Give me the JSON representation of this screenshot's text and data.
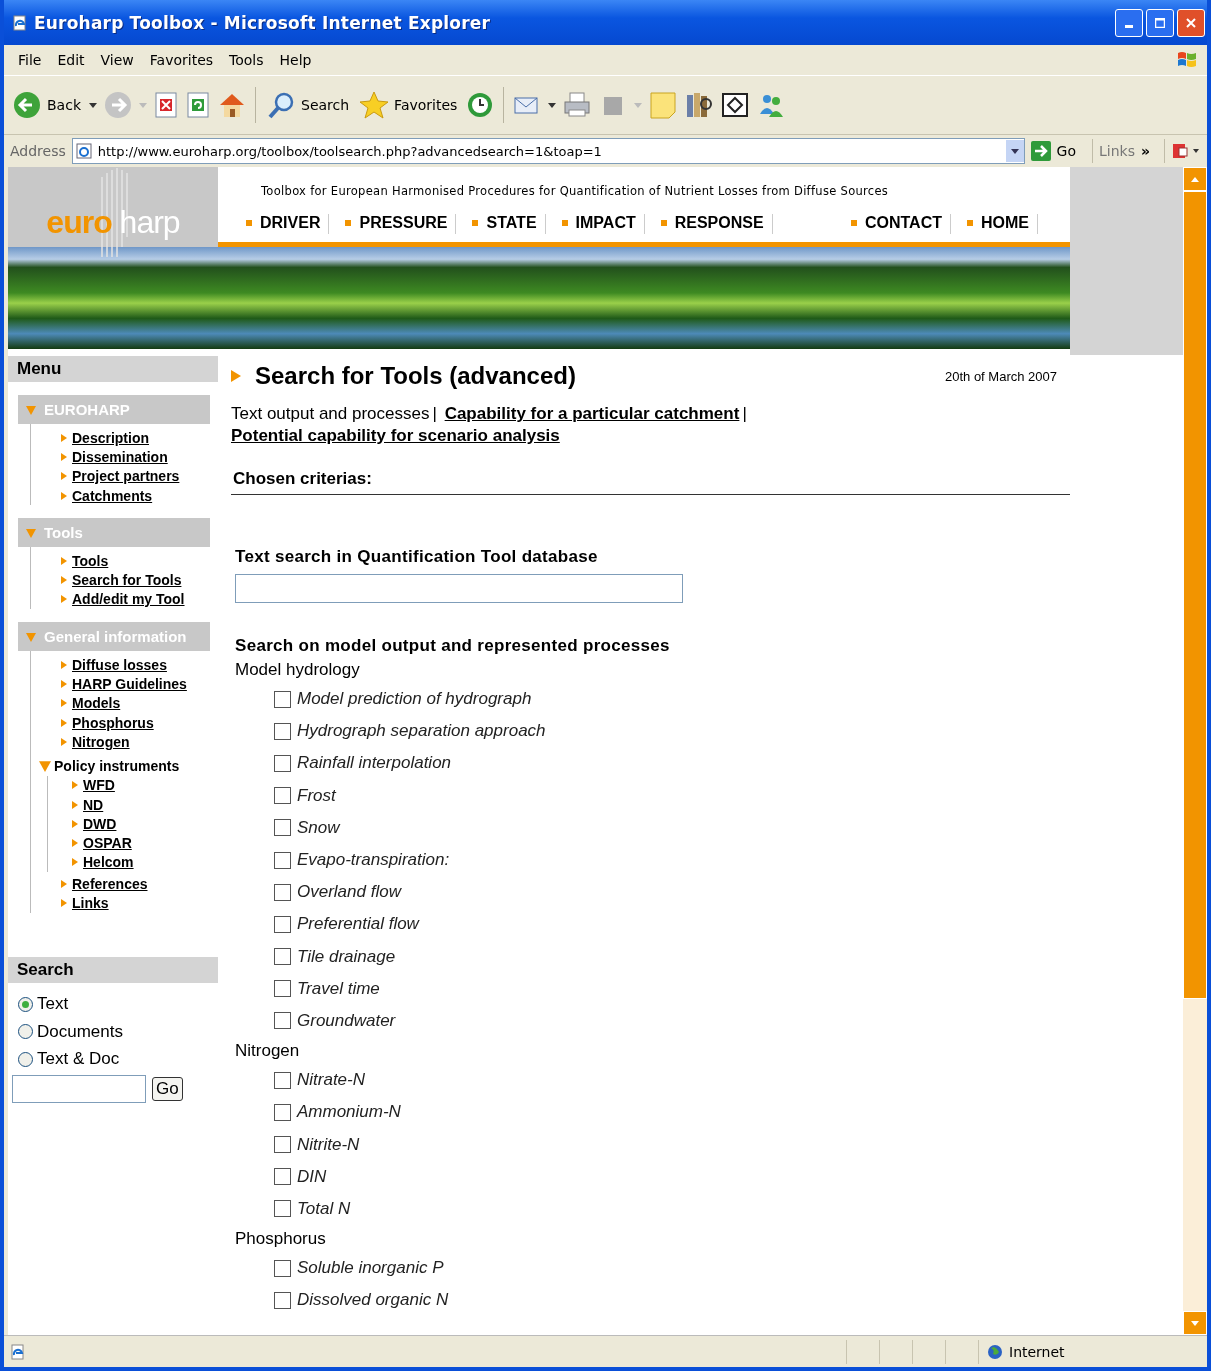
{
  "window": {
    "title": "Euroharp Toolbox - Microsoft Internet Explorer"
  },
  "menu_bar": [
    "File",
    "Edit",
    "View",
    "Favorites",
    "Tools",
    "Help"
  ],
  "toolbar": {
    "back": "Back",
    "search": "Search",
    "favorites": "Favorites"
  },
  "address_bar": {
    "label": "Address",
    "url": "http://www.euroharp.org/toolbox/toolsearch.php?advancedsearch=1&toap=1",
    "go": "Go",
    "links": "Links",
    "chevron": "»"
  },
  "site": {
    "logo_first": "euro",
    "logo_second": "harp",
    "tagline": "Toolbox for European Harmonised Procedures for Quantification of Nutrient Losses from Diffuse Sources",
    "nav_left": [
      "DRIVER",
      "PRESSURE",
      "STATE",
      "IMPACT",
      "RESPONSE"
    ],
    "nav_right": [
      "CONTACT",
      "HOME"
    ]
  },
  "sidebar": {
    "title": "Menu",
    "sections": [
      {
        "title": "EUROHARP",
        "expanded": true,
        "items": [
          {
            "label": "Description"
          },
          {
            "label": "Dissemination"
          },
          {
            "label": "Project partners"
          },
          {
            "label": "Catchments"
          }
        ]
      },
      {
        "title": "Tools",
        "expanded": true,
        "items": [
          {
            "label": "Tools"
          },
          {
            "label": "Search for Tools"
          },
          {
            "label": "Add/edit my Tool"
          }
        ]
      },
      {
        "title": "General information",
        "expanded": true,
        "items": [
          {
            "label": "Diffuse losses"
          },
          {
            "label": "HARP Guidelines"
          },
          {
            "label": "Models"
          },
          {
            "label": "Phosphorus"
          },
          {
            "label": "Nitrogen"
          },
          {
            "label": "Policy instruments",
            "expanded": true,
            "children": [
              {
                "label": "WFD"
              },
              {
                "label": "ND"
              },
              {
                "label": "DWD"
              },
              {
                "label": "OSPAR"
              },
              {
                "label": "Helcom"
              }
            ]
          },
          {
            "label": "References"
          },
          {
            "label": "Links"
          }
        ]
      }
    ]
  },
  "search_box": {
    "title": "Search",
    "options": [
      {
        "label": "Text",
        "selected": true
      },
      {
        "label": "Documents",
        "selected": false
      },
      {
        "label": "Text & Doc",
        "selected": false
      }
    ],
    "go": "Go"
  },
  "main": {
    "title": "Search for Tools (advanced)",
    "date": "20th of March 2007",
    "tabs": [
      {
        "label": "Text output and processes",
        "selected": true
      },
      {
        "label": "Capability for a particular catchment",
        "selected": false
      },
      {
        "label": "Potential capability for scenario analysis",
        "selected": false
      }
    ],
    "separators": [
      "|",
      "|"
    ],
    "criteria_heading": "Chosen criterias:",
    "text_search_heading": "Text search in Quantification Tool database",
    "process_heading": "Search on model output and represented processes",
    "groups": [
      {
        "title": "Model hydrology",
        "options": [
          {
            "label": "Model prediction of hydrograph",
            "checked": false
          },
          {
            "label": "Hydrograph separation approach",
            "checked": false
          },
          {
            "label": "Rainfall interpolation",
            "checked": false
          },
          {
            "label": "Frost",
            "checked": false
          },
          {
            "label": "Snow",
            "checked": false
          },
          {
            "label": "Evapo-transpiration:",
            "checked": false
          },
          {
            "label": "Overland flow",
            "checked": false
          },
          {
            "label": "Preferential flow",
            "checked": false
          },
          {
            "label": "Tile drainage",
            "checked": false
          },
          {
            "label": "Travel time",
            "checked": false
          },
          {
            "label": "Groundwater",
            "checked": false
          }
        ]
      },
      {
        "title": "Nitrogen",
        "options": [
          {
            "label": "Nitrate-N",
            "checked": false
          },
          {
            "label": "Ammonium-N",
            "checked": false
          },
          {
            "label": "Nitrite-N",
            "checked": false
          },
          {
            "label": "DIN",
            "checked": false
          },
          {
            "label": "Total N",
            "checked": false
          }
        ]
      },
      {
        "title": "Phosphorus",
        "options": [
          {
            "label": "Soluble inorganic P",
            "checked": false
          },
          {
            "label": "Dissolved organic N",
            "checked": false
          }
        ]
      }
    ]
  },
  "status_bar": {
    "zone": "Internet"
  }
}
